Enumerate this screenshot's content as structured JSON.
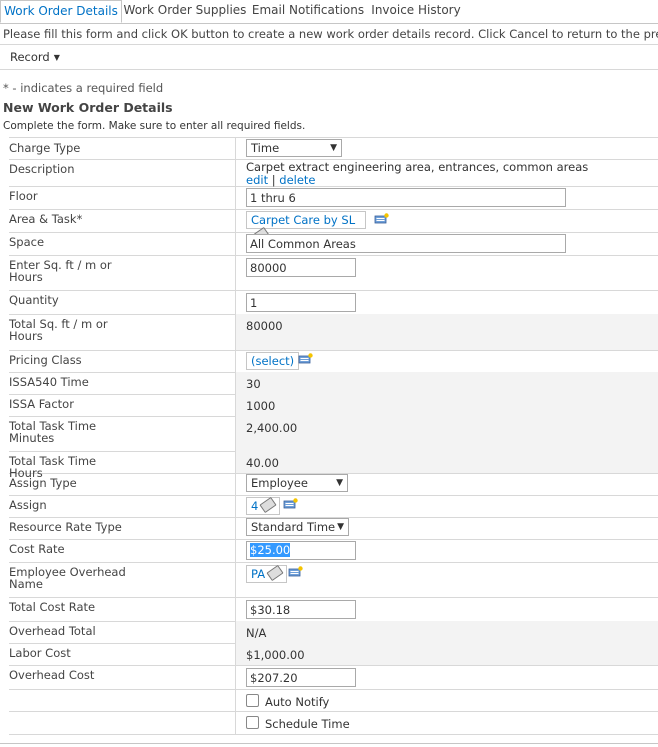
{
  "tabs": [
    {
      "label": "Work Order Details"
    },
    {
      "label": "Work Order Supplies"
    },
    {
      "label": "Email Notifications"
    },
    {
      "label": "Invoice History"
    }
  ],
  "instructions": "Please fill this form and click OK button to create a new work order details record. Click Cancel to return to the previous",
  "record_menu": "Record",
  "required_note": "* - indicates a required field",
  "form_title": "New Work Order Details",
  "form_subtitle": "Complete the form. Make sure to enter all required fields.",
  "fields": {
    "charge_type": {
      "label": "Charge Type",
      "value": "Time"
    },
    "description": {
      "label": "Description",
      "value": "Carpet extract engineering area, entrances, common areas",
      "edit": "edit",
      "sep": "|",
      "delete": "delete"
    },
    "floor": {
      "label": "Floor",
      "value": "1 thru 6"
    },
    "area_task": {
      "label": "Area & Task",
      "required": "*",
      "value": "Carpet Care by SL"
    },
    "space": {
      "label": "Space",
      "value": "All Common Areas"
    },
    "enter_sqft": {
      "label": "Enter Sq. ft / m or Hours",
      "value": "80000"
    },
    "quantity": {
      "label": "Quantity",
      "value": "1"
    },
    "total_sqft": {
      "label": "Total Sq. ft / m or Hours",
      "value": "80000"
    },
    "pricing_class": {
      "label": "Pricing Class",
      "value": "(select)"
    },
    "issa540_time": {
      "label": "ISSA540 Time",
      "value": "30"
    },
    "issa_factor": {
      "label": "ISSA Factor",
      "value": "1000"
    },
    "total_task_min": {
      "label": "Total Task Time Minutes",
      "value": "2,400.00"
    },
    "total_task_hours": {
      "label": "Total Task Time Hours",
      "value": "40.00"
    },
    "assign_type": {
      "label": "Assign Type",
      "value": "Employee"
    },
    "assign": {
      "label": "Assign",
      "value": "4"
    },
    "resource_rate_type": {
      "label": "Resource Rate Type",
      "value": "Standard Time"
    },
    "cost_rate": {
      "label": "Cost Rate",
      "value": "$25.00"
    },
    "emp_overhead": {
      "label": "Employee Overhead Name",
      "value": "PA"
    },
    "total_cost_rate": {
      "label": "Total Cost Rate",
      "value": "$30.18"
    },
    "overhead_total": {
      "label": "Overhead Total",
      "value": "N/A"
    },
    "labor_cost": {
      "label": "Labor Cost",
      "value": "$1,000.00"
    },
    "overhead_cost": {
      "label": "Overhead Cost",
      "value": "$207.20"
    },
    "auto_notify": {
      "label": "Auto Notify",
      "checked": false
    },
    "schedule_time": {
      "label": "Schedule Time",
      "checked": false
    }
  },
  "colors": {
    "accent": "#0072c6",
    "border": "#d8d8d8",
    "selection": "#3399ff"
  }
}
